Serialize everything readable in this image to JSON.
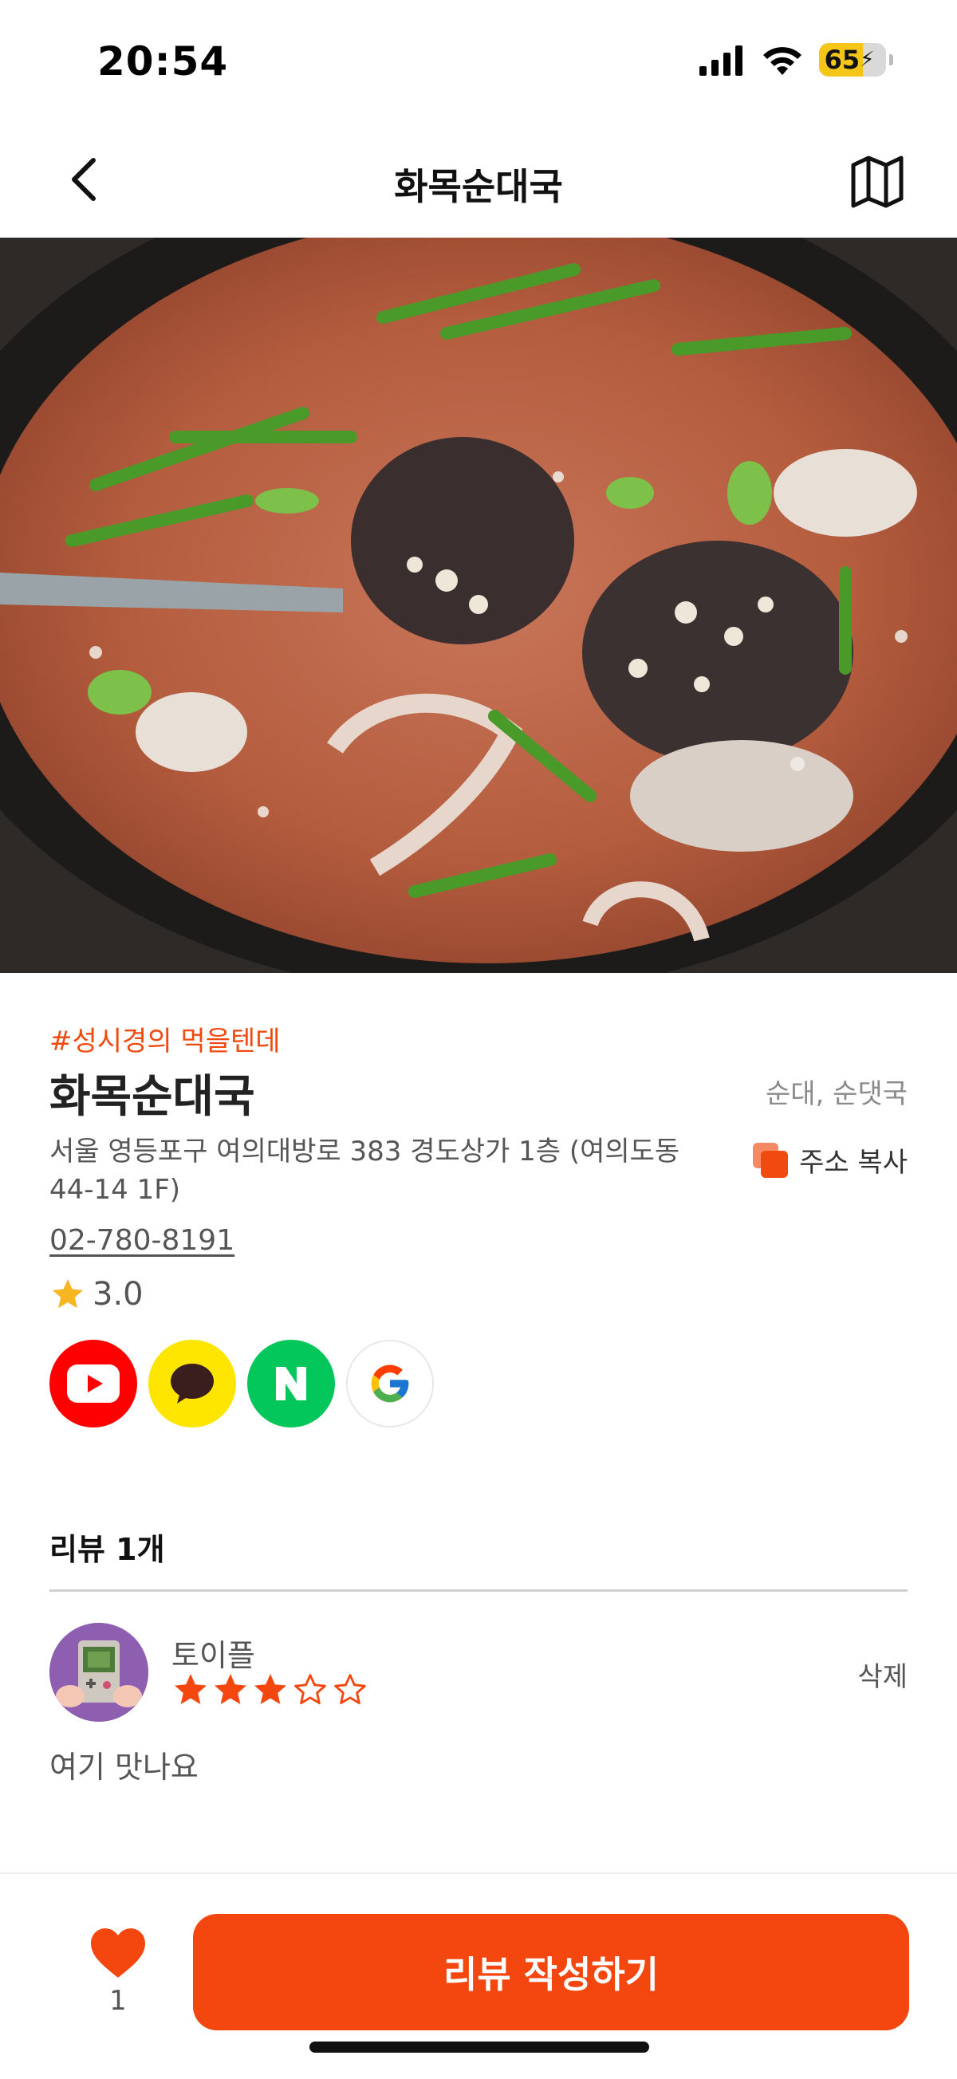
{
  "status_bar": {
    "time": "20:54",
    "battery_percent": "65",
    "icons": [
      "signal-icon",
      "wifi-icon",
      "battery-charging-icon"
    ]
  },
  "nav": {
    "title": "화목순대국",
    "back_icon": "chevron-left-icon",
    "map_icon": "map-icon"
  },
  "restaurant": {
    "hashtag": "#성시경의 먹을텐데",
    "name": "화목순대국",
    "category": "순대, 순댓국",
    "address": "서울 영등포구 여의대방로 383 경도상가 1층 (여의도동 44-14 1F)",
    "copy_address_label": "주소 복사",
    "phone": "02-780-8191",
    "rating": "3.0",
    "external_links": [
      {
        "name": "youtube",
        "color": "#ff0000"
      },
      {
        "name": "kakao",
        "color": "#fee500"
      },
      {
        "name": "naver",
        "color": "#03c75a",
        "glyph": "N"
      },
      {
        "name": "google",
        "color": "#ffffff"
      }
    ]
  },
  "reviews": {
    "title": "리뷰 1개",
    "items": [
      {
        "author": "토이플",
        "rating": 3,
        "max_rating": 5,
        "text": "여기 맛나요",
        "delete_label": "삭제"
      }
    ]
  },
  "bottom_bar": {
    "like_count": "1",
    "write_review_label": "리뷰 작성하기"
  },
  "colors": {
    "accent": "#f4460f",
    "star_yellow": "#f6b521"
  }
}
